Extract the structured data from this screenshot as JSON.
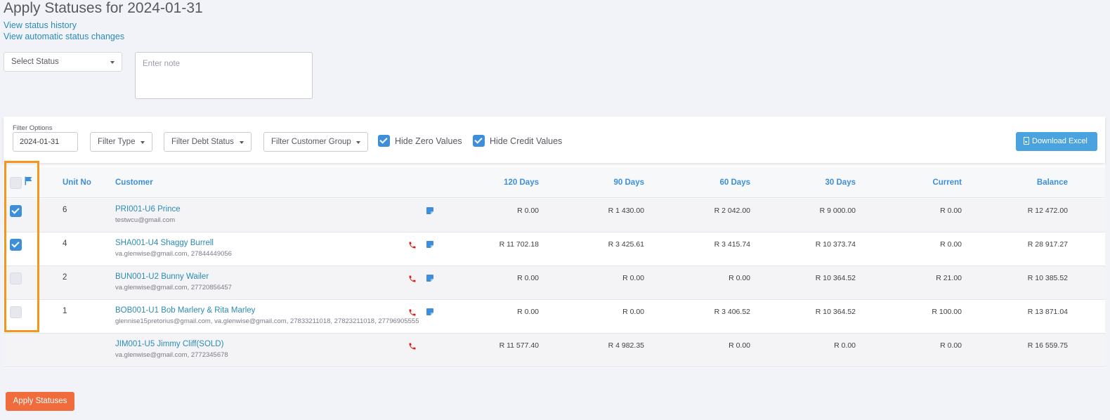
{
  "page": {
    "title": "Apply Statuses for 2024-01-31",
    "link_history": "View status history",
    "link_auto": "View automatic status changes"
  },
  "status_form": {
    "select_value": "Select Status",
    "note_placeholder": "Enter note"
  },
  "filters": {
    "label": "Filter Options",
    "date_value": "2024-01-31",
    "type": "Filter Type",
    "debt_status": "Filter Debt Status",
    "customer_group": "Filter Customer Group",
    "hide_zero": "Hide Zero Values",
    "hide_zero_checked": true,
    "hide_credit": "Hide Credit Values",
    "hide_credit_checked": true,
    "download": "Download Excel"
  },
  "table": {
    "headers": {
      "unit": "Unit No",
      "customer": "Customer",
      "d120": "120 Days",
      "d90": "90 Days",
      "d60": "60 Days",
      "d30": "30 Days",
      "current": "Current",
      "balance": "Balance"
    },
    "rows": [
      {
        "checked": true,
        "unit": "6",
        "customer": "PRI001-U6 Prince",
        "contact": "testwcu@gmail.com",
        "phone": false,
        "notes": true,
        "d120": "R 0.00",
        "d90": "R 1 430.00",
        "d60": "R 2 042.00",
        "d30": "R 9 000.00",
        "current": "R 0.00",
        "balance": "R 12 472.00"
      },
      {
        "checked": true,
        "unit": "4",
        "customer": "SHA001-U4 Shaggy Burrell",
        "contact": "va.glenwise@gmail.com, 27844449056",
        "phone": true,
        "notes": true,
        "d120": "R 11 702.18",
        "d90": "R 3 425.61",
        "d60": "R 3 415.74",
        "d30": "R 10 373.74",
        "current": "R 0.00",
        "balance": "R 28 917.27"
      },
      {
        "checked": false,
        "unit": "2",
        "customer": "BUN001-U2 Bunny Wailer",
        "contact": "va.glenwise@gmail.com, 27720856457",
        "phone": true,
        "notes": true,
        "d120": "R 0.00",
        "d90": "R 0.00",
        "d60": "R 0.00",
        "d30": "R 10 364.52",
        "current": "R 21.00",
        "balance": "R 10 385.52"
      },
      {
        "checked": false,
        "unit": "1",
        "customer": "BOB001-U1 Bob Marlery & Rita Marley",
        "contact": "glennise15pretorius@gmail.com, va.glenwise@gmail.com, 27833211018, 27823211018, 27796905555",
        "phone": true,
        "notes": true,
        "d120": "R 0.00",
        "d90": "R 0.00",
        "d60": "R 3 406.52",
        "d30": "R 10 364.52",
        "current": "R 100.00",
        "balance": "R 13 871.04"
      },
      {
        "checked": null,
        "unit": "",
        "customer": "JIM001-U5 Jimmy Cliff(SOLD)",
        "contact": "va.glenwise@gmail.com, 2772345678",
        "phone": true,
        "notes": false,
        "d120": "R 11 577.40",
        "d90": "R 4 982.35",
        "d60": "R 0.00",
        "d30": "R 0.00",
        "current": "R 0.00",
        "balance": "R 16 559.75"
      }
    ]
  },
  "apply_button": "Apply Statuses",
  "colors": {
    "accent": "#3d8fdb",
    "link": "#2a8bb7",
    "highlight": "#f3961b",
    "apply": "#f06c3c",
    "phone": "#e01a1a"
  }
}
